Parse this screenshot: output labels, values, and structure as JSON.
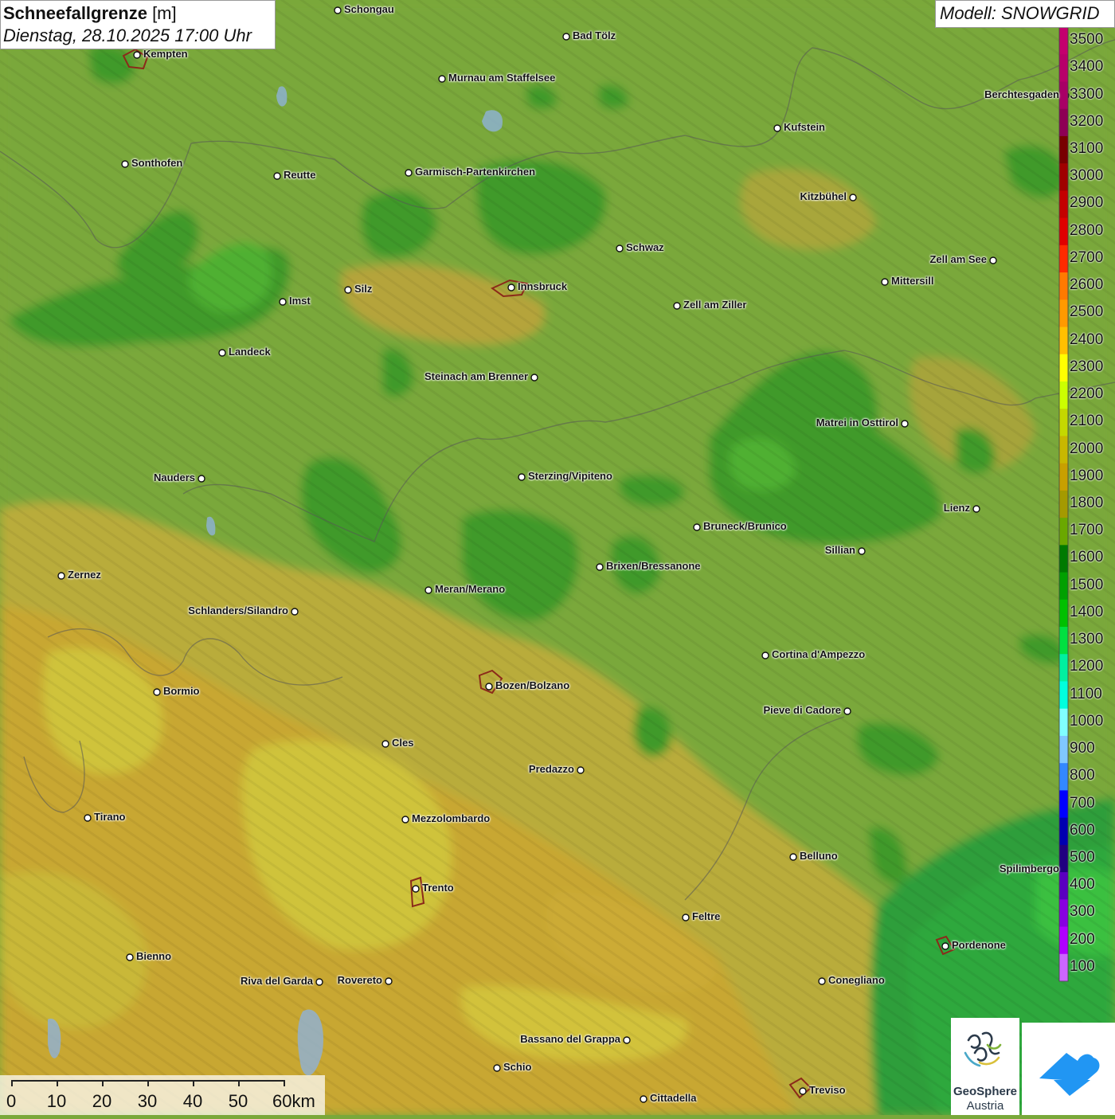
{
  "header": {
    "title": "Schneefallgrenze",
    "unit": " [m]",
    "datetime": "Dienstag, 28.10.2025 17:00 Uhr"
  },
  "model_label": "Modell: SNOWGRID",
  "legend": {
    "levels": [
      {
        "value": "3500",
        "color": "#c4006e"
      },
      {
        "value": "3400",
        "color": "#b8006a"
      },
      {
        "value": "3300",
        "color": "#a80066"
      },
      {
        "value": "3200",
        "color": "#8e0055"
      },
      {
        "value": "3100",
        "color": "#780000"
      },
      {
        "value": "3000",
        "color": "#a00000"
      },
      {
        "value": "2900",
        "color": "#c40000"
      },
      {
        "value": "2800",
        "color": "#e00000"
      },
      {
        "value": "2700",
        "color": "#ff2a00"
      },
      {
        "value": "2600",
        "color": "#ff7a00"
      },
      {
        "value": "2500",
        "color": "#ff9a00"
      },
      {
        "value": "2400",
        "color": "#ffc000"
      },
      {
        "value": "2300",
        "color": "#ffff00"
      },
      {
        "value": "2200",
        "color": "#ccff00"
      },
      {
        "value": "2100",
        "color": "#c4d800"
      },
      {
        "value": "2000",
        "color": "#c8b800"
      },
      {
        "value": "1900",
        "color": "#c8a000"
      },
      {
        "value": "1800",
        "color": "#a49a00"
      },
      {
        "value": "1700",
        "color": "#6aa800"
      },
      {
        "value": "1600",
        "color": "#007a00"
      },
      {
        "value": "1500",
        "color": "#00a000"
      },
      {
        "value": "1400",
        "color": "#00c000"
      },
      {
        "value": "1300",
        "color": "#00e040"
      },
      {
        "value": "1200",
        "color": "#00f0a0"
      },
      {
        "value": "1100",
        "color": "#00ffdd"
      },
      {
        "value": "1000",
        "color": "#80ffff"
      },
      {
        "value": "900",
        "color": "#80c8ff"
      },
      {
        "value": "800",
        "color": "#3388ff"
      },
      {
        "value": "700",
        "color": "#0000ff"
      },
      {
        "value": "600",
        "color": "#0000b0"
      },
      {
        "value": "500",
        "color": "#200080"
      },
      {
        "value": "400",
        "color": "#5a00c0"
      },
      {
        "value": "300",
        "color": "#8800e0"
      },
      {
        "value": "200",
        "color": "#b000ff"
      },
      {
        "value": "100",
        "color": "#cc66ff"
      }
    ]
  },
  "scale_bar": {
    "labels": [
      "0",
      "10",
      "20",
      "30",
      "40",
      "50",
      "60km"
    ]
  },
  "logos": {
    "geosphere_line1": "GeoSphere",
    "geosphere_line2": "Austria"
  },
  "cities": [
    {
      "name": "Schongau"
    },
    {
      "name": "Bad Tölz"
    },
    {
      "name": "Kempten"
    },
    {
      "name": "Murnau am Staffelsee"
    },
    {
      "name": "Berchtesgaden"
    },
    {
      "name": "Kufstein"
    },
    {
      "name": "Sonthofen"
    },
    {
      "name": "Reutte"
    },
    {
      "name": "Garmisch-Partenkirchen"
    },
    {
      "name": "Kitzbühel"
    },
    {
      "name": "Schwaz"
    },
    {
      "name": "Zell am See"
    },
    {
      "name": "Innsbruck"
    },
    {
      "name": "Mittersill"
    },
    {
      "name": "Imst"
    },
    {
      "name": "Silz"
    },
    {
      "name": "Zell am Ziller"
    },
    {
      "name": "Landeck"
    },
    {
      "name": "Steinach am Brenner"
    },
    {
      "name": "Matrei in Osttirol"
    },
    {
      "name": "Nauders"
    },
    {
      "name": "Sterzing/Vipiteno"
    },
    {
      "name": "Lienz"
    },
    {
      "name": "Bruneck/Brunico"
    },
    {
      "name": "Sillian"
    },
    {
      "name": "Zernez"
    },
    {
      "name": "Brixen/Bressanone"
    },
    {
      "name": "Meran/Merano"
    },
    {
      "name": "Schlanders/Silandro"
    },
    {
      "name": "Cortina d'Ampezzo"
    },
    {
      "name": "Bozen/Bolzano"
    },
    {
      "name": "Bormio"
    },
    {
      "name": "Pieve di Cadore"
    },
    {
      "name": "Cles"
    },
    {
      "name": "Predazzo"
    },
    {
      "name": "Tirano"
    },
    {
      "name": "Mezzolombardo"
    },
    {
      "name": "Belluno"
    },
    {
      "name": "Spilimbergo"
    },
    {
      "name": "Trento"
    },
    {
      "name": "Feltre"
    },
    {
      "name": "Pordenone"
    },
    {
      "name": "Bienno"
    },
    {
      "name": "Riva del Garda"
    },
    {
      "name": "Rovereto"
    },
    {
      "name": "Conegliano"
    },
    {
      "name": "Bassano del Grappa"
    },
    {
      "name": "Schio"
    },
    {
      "name": "Treviso"
    },
    {
      "name": "Cittadella"
    }
  ]
}
